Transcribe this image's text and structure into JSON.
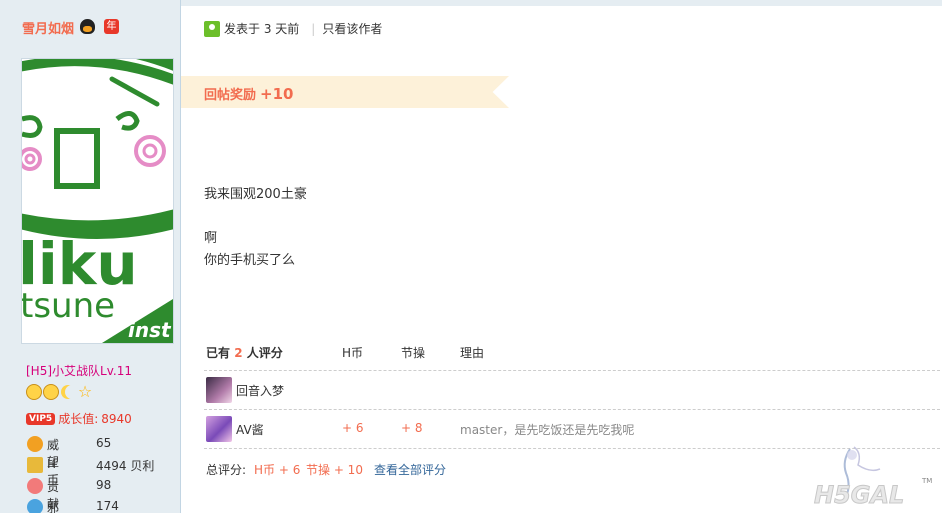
{
  "author": {
    "name": "雪月如烟",
    "icons": [
      "qq-icon",
      "nian-icon"
    ],
    "nian_label": "年"
  },
  "profile": {
    "avatar_text": "liku tsune inst",
    "group": "[H5]小艾战队Lv.11",
    "medals": [
      "sun-icon",
      "sun-icon",
      "moon-icon",
      "star-icon"
    ],
    "vip_label": "VIP5",
    "growth_label": "成长值:",
    "growth_value": "8940",
    "stats": [
      {
        "icon": "prestige-icon",
        "label": "威望",
        "value": "65"
      },
      {
        "icon": "hcoin-icon",
        "label": "H币",
        "value": "4494 贝利"
      },
      {
        "icon": "contribution-icon",
        "label": "贡献",
        "value": "98"
      },
      {
        "icon": "evil-icon",
        "label": "邪恶",
        "value": "174"
      }
    ]
  },
  "post": {
    "posted": "发表于 3 天前",
    "only_author": "只看该作者",
    "reward_label": "回帖奖励",
    "reward_value": "+10",
    "lines": [
      "我来围观200土豪",
      "啊",
      "你的手机买了么"
    ]
  },
  "rating": {
    "header_prefix": "已有",
    "count": "2",
    "header_suffix": "人评分",
    "col_hcoin": "H币",
    "col_jiecao": "节操",
    "col_reason": "理由",
    "rows": [
      {
        "name": "回音入梦",
        "hcoin": "",
        "jiecao": "",
        "reason": ""
      },
      {
        "name": "AV酱",
        "hcoin": "+ 6",
        "jiecao": "+ 8",
        "reason": "master，是先吃饭还是先吃我呢"
      }
    ],
    "total_label": "总评分:",
    "total_hcoin": "H币 + 6",
    "total_jiecao": "节操 + 10",
    "view_all": "查看全部评分"
  },
  "watermark": {
    "text": "H5GAL",
    "tm": "TM"
  },
  "colors": {
    "accent": "#f26c4f",
    "link": "#336699",
    "sidebar_bg": "#e5edf2",
    "group": "#d6007a",
    "miku_green": "#2e8b2e"
  }
}
